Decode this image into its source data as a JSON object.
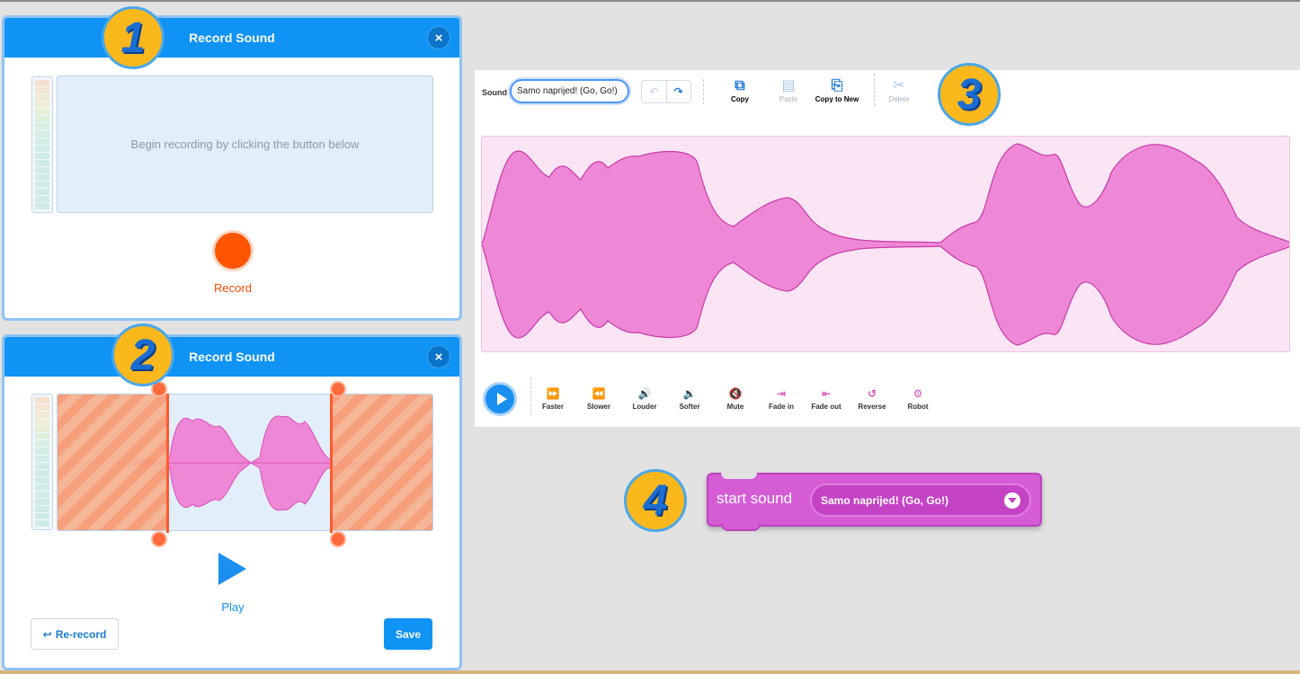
{
  "dialog1": {
    "title": "Record Sound",
    "close": "×",
    "hint": "Begin recording by clicking the button below",
    "record_label": "Record"
  },
  "dialog2": {
    "title": "Record Sound",
    "close": "×",
    "play_label": "Play",
    "rerecord_label": "Re-record",
    "save_label": "Save"
  },
  "badges": [
    "1",
    "2",
    "3",
    "4"
  ],
  "editor": {
    "sound_label": "Sound",
    "sound_name": "Samo naprijed! (Go, Go!)",
    "tools": [
      {
        "label": "Copy",
        "icon": "copy-icon",
        "enabled": true
      },
      {
        "label": "Paste",
        "icon": "paste-icon",
        "enabled": false
      },
      {
        "label": "Copy to New",
        "icon": "copy-to-new-icon",
        "enabled": true
      },
      {
        "label": "Delete",
        "icon": "scissors-icon",
        "enabled": false
      }
    ],
    "effects": [
      {
        "label": "Faster",
        "icon": "faster-icon"
      },
      {
        "label": "Slower",
        "icon": "slower-icon"
      },
      {
        "label": "Louder",
        "icon": "louder-icon"
      },
      {
        "label": "Softer",
        "icon": "softer-icon"
      },
      {
        "label": "Mute",
        "icon": "mute-icon"
      },
      {
        "label": "Fade in",
        "icon": "fade-in-icon"
      },
      {
        "label": "Fade out",
        "icon": "fade-out-icon"
      },
      {
        "label": "Reverse",
        "icon": "reverse-icon"
      },
      {
        "label": "Robot",
        "icon": "robot-icon"
      }
    ]
  },
  "block": {
    "text": "start sound",
    "dropdown_value": "Samo naprijed! (Go, Go!)"
  },
  "colors": {
    "accent": "#0f93f4",
    "record": "#ff5500",
    "sound_purple": "#d65cd6",
    "wave_fill": "#ee88d6",
    "badge": "#fbb81d"
  }
}
